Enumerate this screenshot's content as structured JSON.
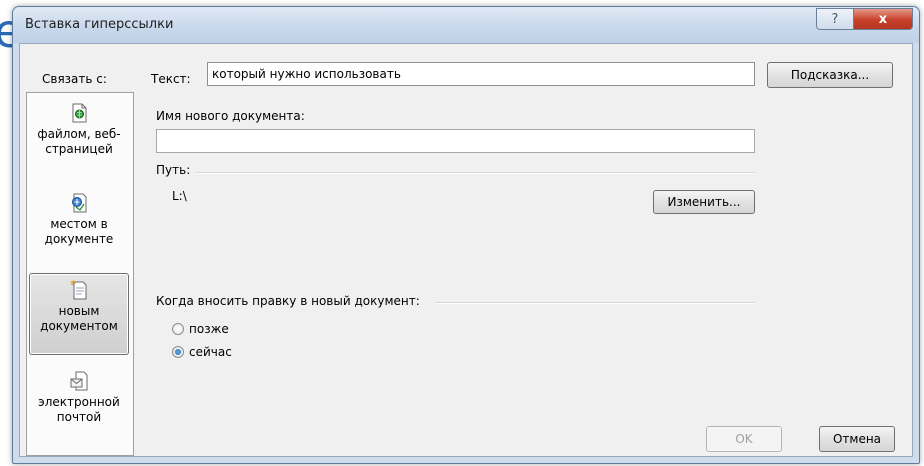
{
  "background": {
    "partial_glyph": "e"
  },
  "window": {
    "title": "Вставка гиперссылки",
    "help_label": "?",
    "close_label": "x"
  },
  "link_to_label": "Связать с:",
  "sidebar": {
    "items": [
      {
        "label_line1": "файлом, веб-",
        "label_line2": "страницей",
        "icon": "web-page-icon"
      },
      {
        "label_line1": "местом в",
        "label_line2": "документе",
        "icon": "bookmark-place-icon"
      },
      {
        "label_line1": "новым",
        "label_line2": "документом",
        "icon": "new-document-icon"
      },
      {
        "label_line1": "электронной",
        "label_line2": "почтой",
        "icon": "email-icon"
      }
    ]
  },
  "text_field": {
    "label": "Текст:",
    "value": "который нужно использовать"
  },
  "hint_button": "Подсказка...",
  "new_document": {
    "label": "Имя нового документа:",
    "value": "",
    "path_label": "Путь:",
    "path_value": "L:\\",
    "change_button": "Изменить..."
  },
  "edit_when": {
    "label": "Когда вносить правку в новый документ:",
    "options": [
      {
        "label": "позже",
        "selected": false
      },
      {
        "label": "сейчас",
        "selected": true
      }
    ]
  },
  "buttons": {
    "ok": "OK",
    "cancel": "Отмена"
  },
  "colors": {
    "accent": "#2a6ab4",
    "close": "#c7402a"
  }
}
